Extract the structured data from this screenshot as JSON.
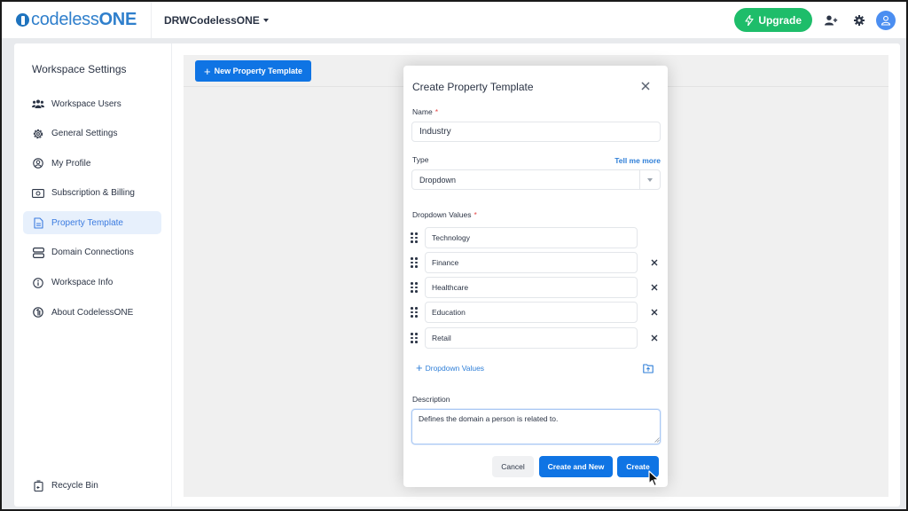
{
  "app": {
    "logo_prefix": "codeless",
    "logo_suffix": "ONE",
    "workspace_name": "DRWCodelessONE",
    "upgrade_label": "Upgrade",
    "accent": "#0f74e4",
    "upgrade_color": "#1ebd6a"
  },
  "sidebar": {
    "title": "Workspace Settings",
    "items": [
      {
        "label": "Workspace Users",
        "icon": "users-icon",
        "active": false
      },
      {
        "label": "General Settings",
        "icon": "gear-icon",
        "active": false
      },
      {
        "label": "My Profile",
        "icon": "user-circle-icon",
        "active": false
      },
      {
        "label": "Subscription & Billing",
        "icon": "money-icon",
        "active": false
      },
      {
        "label": "Property Template",
        "icon": "document-icon",
        "active": true
      },
      {
        "label": "Domain Connections",
        "icon": "server-icon",
        "active": false
      },
      {
        "label": "Workspace Info",
        "icon": "info-icon",
        "active": false
      },
      {
        "label": "About CodelessONE",
        "icon": "codelessone-icon",
        "active": false
      }
    ],
    "bottom_item": {
      "label": "Recycle Bin",
      "icon": "recycle-bin-icon"
    }
  },
  "content": {
    "new_button_label": "New Property Template"
  },
  "modal": {
    "title": "Create Property Template",
    "name_label": "Name",
    "name_value": "Industry",
    "type_label": "Type",
    "tell_more": "Tell me more",
    "type_value": "Dropdown",
    "dropdown_values_label": "Dropdown Values",
    "dropdown_values": [
      "Technology",
      "Finance",
      "Healthcare",
      "Education",
      "Retail"
    ],
    "add_values_label": "Dropdown Values",
    "description_label": "Description",
    "description_value": "Defines the domain a person is related to.",
    "cancel_label": "Cancel",
    "create_new_label": "Create and New",
    "create_label": "Create",
    "required_mark": "*"
  }
}
